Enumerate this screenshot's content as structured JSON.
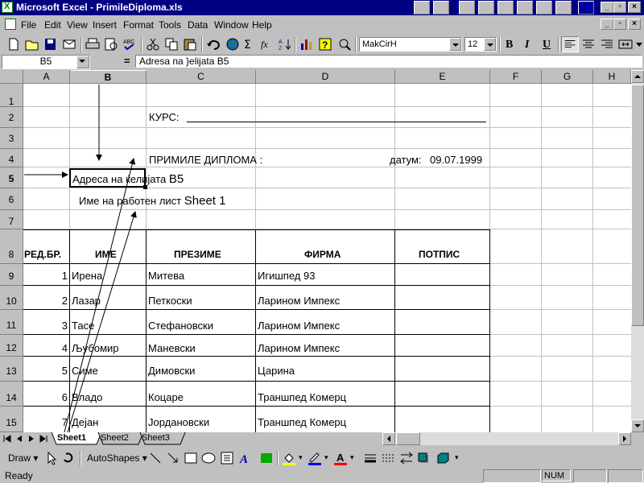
{
  "window": {
    "title": "Microsoft Excel - PrimileDiploma.xls"
  },
  "menu": [
    "File",
    "Edit",
    "View",
    "Insert",
    "Format",
    "Tools",
    "Data",
    "Window",
    "Help"
  ],
  "toolbar": {
    "font_name": "MakCirH",
    "font_size": "12",
    "bold": "B",
    "italic": "I",
    "underline": "U"
  },
  "formula_bar": {
    "name_box": "B5",
    "equals": "=",
    "content": "Adresa na }elijata B5"
  },
  "columns": [
    "A",
    "B",
    "C",
    "D",
    "E",
    "F",
    "G",
    "H"
  ],
  "rows": [
    "1",
    "2",
    "3",
    "4",
    "5",
    "6",
    "7",
    "8",
    "9",
    "10",
    "11",
    "12",
    "13",
    "14",
    "15"
  ],
  "sheet": {
    "course_label": "КУРС:",
    "received_label": "ПРИМИЛЕ ДИПЛОМА :",
    "date_label": "датум:",
    "date_value": "09.07.1999",
    "annot_cell": "Адреса на ќелијата",
    "annot_cell_ref": "B5",
    "annot_sheet": "Име на работен лист",
    "annot_sheet_ref": "Sheet 1",
    "headers": [
      "РЕД.БР.",
      "ИМЕ",
      "ПРЕЗИМЕ",
      "ФИРМА",
      "ПОТПИС"
    ],
    "table": [
      {
        "n": "1",
        "first": "Ирена",
        "last": "Митева",
        "firm": "Игишпед 93"
      },
      {
        "n": "2",
        "first": "Лазар",
        "last": "Петкоски",
        "firm": "Ларином Импекс"
      },
      {
        "n": "3",
        "first": "Тасе",
        "last": "Стефановски",
        "firm": "Ларином Импекс"
      },
      {
        "n": "4",
        "first": "Љубомир",
        "last": "Маневски",
        "firm": "Ларином Импекс"
      },
      {
        "n": "5",
        "first": "Симе",
        "last": "Димовски",
        "firm": "Царина"
      },
      {
        "n": "6",
        "first": "Владо",
        "last": "Коцаре",
        "firm": "Траншпед Комерц"
      },
      {
        "n": "7",
        "first": "Дејан",
        "last": "Јордановски",
        "firm": "Траншпед Комерц"
      }
    ]
  },
  "tabs": [
    "Sheet1",
    "Sheet2",
    "Sheet3"
  ],
  "drawbar": {
    "draw": "Draw",
    "autoshapes": "AutoShapes"
  },
  "status": {
    "ready": "Ready",
    "num": "NUM"
  }
}
